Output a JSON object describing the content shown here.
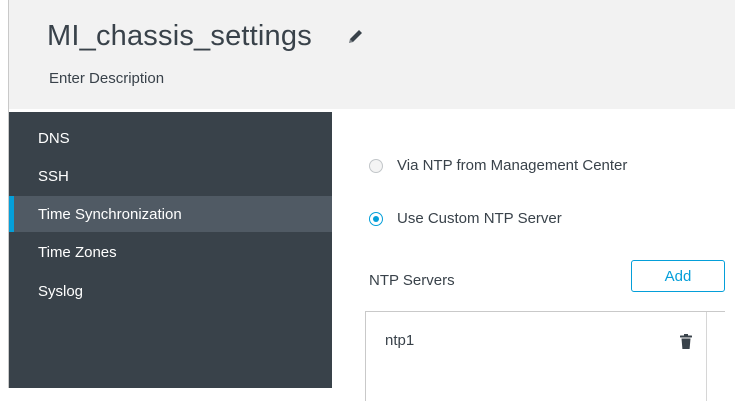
{
  "header": {
    "title": "MI_chassis_settings",
    "description_placeholder": "Enter Description",
    "edit_icon": "pencil-icon"
  },
  "sidebar": {
    "items": [
      {
        "label": "DNS",
        "active": false
      },
      {
        "label": "SSH",
        "active": false
      },
      {
        "label": "Time Synchronization",
        "active": true
      },
      {
        "label": "Time Zones",
        "active": false
      },
      {
        "label": "Syslog",
        "active": false
      }
    ]
  },
  "time_sync": {
    "options": [
      {
        "label": "Via NTP from Management Center",
        "selected": false
      },
      {
        "label": "Use Custom NTP Server",
        "selected": true
      }
    ],
    "ntp_servers_label": "NTP Servers",
    "add_label": "Add",
    "servers": [
      {
        "name": "ntp1",
        "delete_icon": "trash-icon"
      }
    ]
  },
  "colors": {
    "accent": "#049fd9",
    "sidebar_bg": "#39424a",
    "sidebar_active_bg": "#505a64",
    "header_bg": "#f2f2f2",
    "text": "#39424a"
  }
}
